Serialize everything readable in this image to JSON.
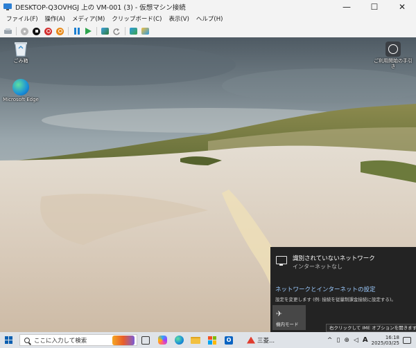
{
  "window": {
    "title": "DESKTOP-Q3OVHGJ 上の VM-001 (3) - 仮想マシン接続",
    "controls": {
      "minimize": "—",
      "maximize": "☐",
      "close": "✕"
    }
  },
  "menu": [
    "ファイル(F)",
    "操作(A)",
    "メディア(M)",
    "クリップボード(C)",
    "表示(V)",
    "ヘルプ(H)"
  ],
  "toolbar_icons": [
    "ctrl-alt-del-icon",
    "start-icon",
    "turn-off-icon",
    "shutdown-icon",
    "save-icon",
    "pause-icon",
    "resume-icon",
    "checkpoint-icon",
    "revert-icon",
    "enhanced-session-icon",
    "share-icon"
  ],
  "desktop": {
    "icons": [
      {
        "label": "ごみ箱"
      },
      {
        "label": "Microsoft Edge"
      },
      {
        "label": "ご利用開始の手引き"
      }
    ]
  },
  "network_flyout": {
    "network_name": "識別されていないネットワーク",
    "network_status": "インターネットなし",
    "settings_link": "ネットワークとインターネットの設定",
    "settings_desc": "設定を変更します (例: 接続を従量制課金接続に設定する)。",
    "airplane_mode": "機内モード"
  },
  "tooltip": "右クリックして IME オプションを開きます",
  "taskbar": {
    "search_placeholder": "ここに入力して検索",
    "running_app": "三菱...",
    "tray_ime": "A",
    "time": "16:18",
    "date": "2025/03/25"
  }
}
